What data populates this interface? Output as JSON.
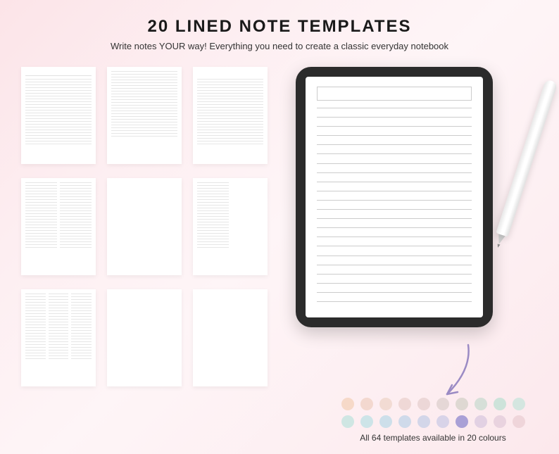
{
  "header": {
    "title": "20 LINED NOTE TEMPLATES",
    "subtitle": "Write notes YOUR way! Everything you need to create a classic everyday notebook"
  },
  "swatches": {
    "caption": "All 64 templates available in 20 colours",
    "row1": [
      "#f6d9c8",
      "#f3d8cf",
      "#f2dbd3",
      "#efd8d6",
      "#ecd7d7",
      "#e5d7d6",
      "#ded8d2",
      "#d6dfd8",
      "#cde3da",
      "#d4e6e0"
    ],
    "row2": [
      "#cfe6e3",
      "#cde4e8",
      "#cddfea",
      "#cfdaea",
      "#d3d6e9",
      "#d8d3e8",
      "#a9a0d6",
      "#e2d1e3",
      "#e9d3df",
      "#efd5da"
    ]
  },
  "lineCount": 24,
  "screenLineCount": 22
}
